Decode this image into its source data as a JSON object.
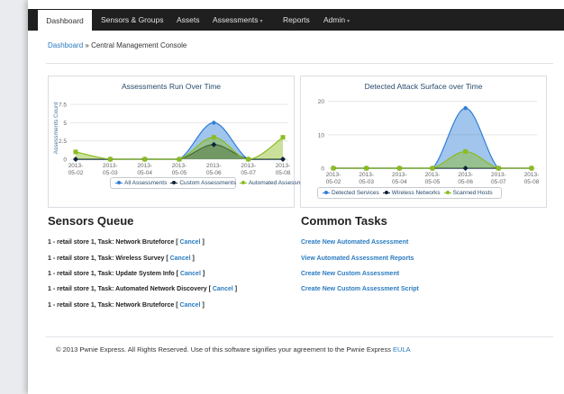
{
  "nav": {
    "items": [
      {
        "label": "Dashboard",
        "active": true,
        "dropdown": false
      },
      {
        "label": "Sensors & Groups",
        "active": false,
        "dropdown": false
      },
      {
        "label": "Assets",
        "active": false,
        "dropdown": false
      },
      {
        "label": "Assessments",
        "active": false,
        "dropdown": true
      },
      {
        "label": "Reports",
        "active": false,
        "dropdown": false
      },
      {
        "label": "Admin",
        "active": false,
        "dropdown": true
      }
    ]
  },
  "breadcrumb": {
    "root": "Dashboard",
    "separator": "»",
    "current": "Central Management Console"
  },
  "chart_data": [
    {
      "type": "area",
      "title": "Assessments Run Over Time",
      "ylabel": "Assessments Count",
      "xlabel": "",
      "categories": [
        "2013-05-02",
        "2013-05-03",
        "2013-05-04",
        "2013-05-05",
        "2013-05-06",
        "2013-05-07",
        "2013-05-08"
      ],
      "yticks": [
        0,
        2.5,
        5,
        7.5
      ],
      "ylim": [
        0,
        8.5
      ],
      "series": [
        {
          "name": "All Assessments",
          "color": "#2f7ed8",
          "values": [
            0,
            0,
            0,
            0,
            5,
            0,
            0
          ]
        },
        {
          "name": "Custom Assessments",
          "color": "#0d233a",
          "values": [
            0,
            0,
            0,
            0,
            2,
            0,
            0
          ]
        },
        {
          "name": "Automated Assessments",
          "color": "#8bbc21",
          "values": [
            1,
            0,
            0,
            0,
            3,
            0,
            3
          ]
        }
      ],
      "legend_placement": "bottom",
      "grid": true
    },
    {
      "type": "area",
      "title": "Detected Attack Surface over Time",
      "ylabel": "",
      "xlabel": "",
      "categories": [
        "2013-05-02",
        "2013-05-03",
        "2013-05-04",
        "2013-05-05",
        "2013-05-06",
        "2013-05-07",
        "2013-05-08"
      ],
      "yticks": [
        0,
        10,
        20
      ],
      "ylim": [
        0,
        21
      ],
      "series": [
        {
          "name": "Detected Services",
          "color": "#2f7ed8",
          "values": [
            0,
            0,
            0,
            0,
            18,
            0,
            0
          ]
        },
        {
          "name": "Wireless Networks",
          "color": "#0d233a",
          "values": [
            0,
            0,
            0,
            0,
            0,
            0,
            0
          ]
        },
        {
          "name": "Scanned Hosts",
          "color": "#8bbc21",
          "values": [
            0,
            0,
            0,
            0,
            5,
            0,
            0
          ]
        }
      ],
      "legend_placement": "bottom",
      "grid": true
    }
  ],
  "sensors_queue": {
    "title": "Sensors Queue",
    "items": [
      {
        "text": "1 - retail store 1, Task: Network Bruteforce",
        "action": "Cancel"
      },
      {
        "text": "1 - retail store 1, Task: Wireless Survey",
        "action": "Cancel"
      },
      {
        "text": "1 - retail store 1, Task: Update System Info",
        "action": "Cancel"
      },
      {
        "text": "1 - retail store 1, Task: Automated Network Discovery",
        "action": "Cancel"
      },
      {
        "text": "1 - retail store 1, Task: Network Bruteforce",
        "action": "Cancel"
      }
    ]
  },
  "common_tasks": {
    "title": "Common Tasks",
    "items": [
      "Create New Automated Assessment",
      "View Automated Assessment Reports",
      "Create New Custom Assessment",
      "Create New Custom Assessment Script"
    ]
  },
  "footer": {
    "text": "© 2013 Pwnie Express. All Rights Reserved. Use of this software signifies your agreement to the Pwnie Express",
    "link": "EULA"
  }
}
